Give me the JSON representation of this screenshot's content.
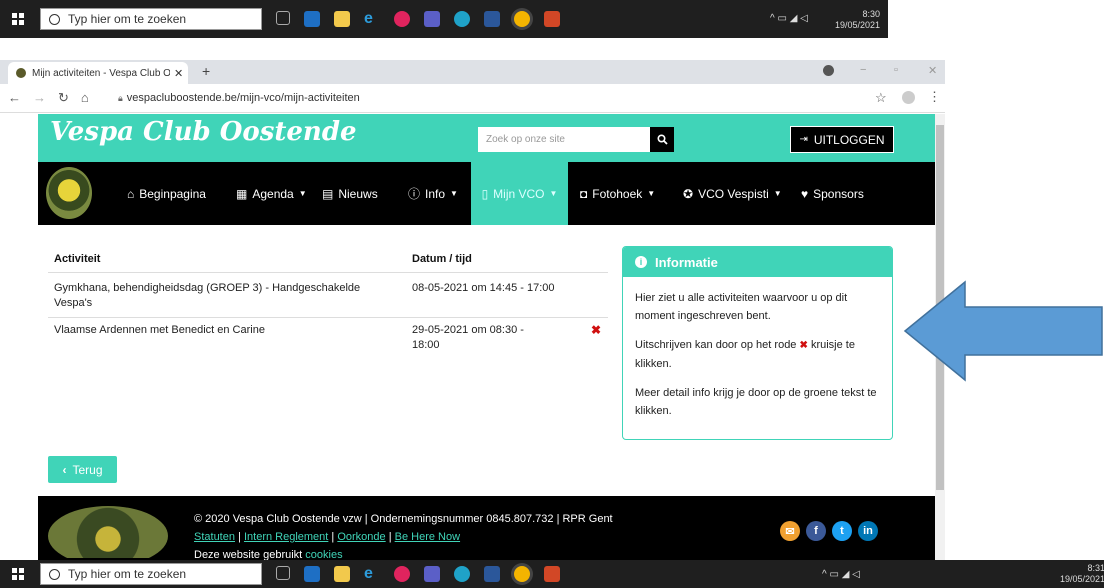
{
  "taskbar": {
    "search_placeholder": "Typ hier om te zoeken",
    "time_top": "8:30",
    "date_top": "19/05/2021",
    "time_bottom": "8:31",
    "date_bottom": "19/05/2021"
  },
  "browser": {
    "tab_title": "Mijn activiteiten - Vespa Club Oo",
    "url": "vespacluboostende.be/mijn-vco/mijn-activiteiten"
  },
  "site": {
    "logo": "Vespa Club Oostende",
    "search_placeholder": "Zoek op onze site",
    "logout_label": "UITLOGGEN",
    "nav": [
      {
        "label": "Beginpagina",
        "icon": "home-icon"
      },
      {
        "label": "Agenda",
        "icon": "calendar-icon"
      },
      {
        "label": "Nieuws",
        "icon": "newspaper-icon"
      },
      {
        "label": "Info",
        "icon": "info-icon"
      },
      {
        "label": "Mijn VCO",
        "icon": "document-icon"
      },
      {
        "label": "Fotohoek",
        "icon": "camera-icon"
      },
      {
        "label": "VCO Vespisti",
        "icon": "badge-icon"
      },
      {
        "label": "Sponsors",
        "icon": "heart-icon"
      }
    ]
  },
  "activities": {
    "col_activity": "Activiteit",
    "col_datetime": "Datum / tijd",
    "rows": [
      {
        "name": "Gymkhana, behendigheidsdag (GROEP 3) - Handgeschakelde Vespa's",
        "datetime": "08-05-2021 om 14:45 - 17:00",
        "removable": false
      },
      {
        "name": "Vlaamse Ardennen met Benedict en Carine",
        "datetime": "29-05-2021 om 08:30 - 18:00",
        "removable": true
      }
    ]
  },
  "info": {
    "title": "Informatie",
    "p1": "Hier ziet u alle activiteiten waarvoor u op dit moment ingeschreven bent.",
    "p2_before": "Uitschrijven kan door op het rode",
    "p2_after": "kruisje te klikken.",
    "p3": "Meer detail info krijg je door op de groene tekst te klikken."
  },
  "back_label": "Terug",
  "footer": {
    "line1": "© 2020 Vespa Club Oostende vzw | Ondernemingsnummer 0845.807.732 | RPR Gent",
    "links": [
      "Statuten",
      "Intern Reglement",
      "Oorkonde",
      "Be Here Now"
    ],
    "cookie_text": "Deze website gebruikt",
    "cookie_link": "cookies"
  },
  "colors": {
    "accent": "#40d4b8",
    "arrow": "#5b9bd5"
  }
}
